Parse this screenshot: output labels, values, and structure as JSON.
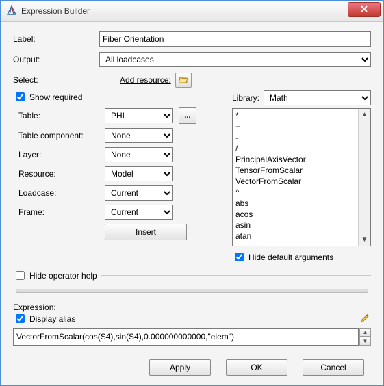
{
  "window": {
    "title": "Expression Builder"
  },
  "fields": {
    "label_lbl": "Label:",
    "label_val": "Fiber Orientation",
    "output_lbl": "Output:",
    "output_val": "All loadcases",
    "select_lbl": "Select:",
    "add_resource": "Add resource:",
    "show_required": "Show required",
    "table_lbl": "Table:",
    "table_val": "PHI",
    "tablecomp_lbl": "Table component:",
    "tablecomp_val": "None",
    "layer_lbl": "Layer:",
    "layer_val": "None",
    "resource_lbl": "Resource:",
    "resource_val": "Model",
    "loadcase_lbl": "Loadcase:",
    "loadcase_val": "Current",
    "frame_lbl": "Frame:",
    "frame_val": "Current",
    "insert_btn": "Insert",
    "library_lbl": "Library:",
    "library_val": "Math",
    "hide_default": "Hide default arguments",
    "hide_op_help": "Hide operator help",
    "expression_lbl": "Expression:",
    "display_alias": "Display alias",
    "expr_val": "VectorFromScalar(cos(S4),sin(S4),0.000000000000,\"elem\")",
    "apply": "Apply",
    "ok": "OK",
    "cancel": "Cancel"
  },
  "library_items": [
    "*",
    "+",
    "-",
    "/",
    "PrincipalAxisVector",
    "TensorFromScalar",
    "VectorFromScalar",
    "^",
    "abs",
    "acos",
    "asin",
    "atan"
  ],
  "icons": {
    "dots": "...",
    "up": "▲",
    "down": "▼"
  }
}
